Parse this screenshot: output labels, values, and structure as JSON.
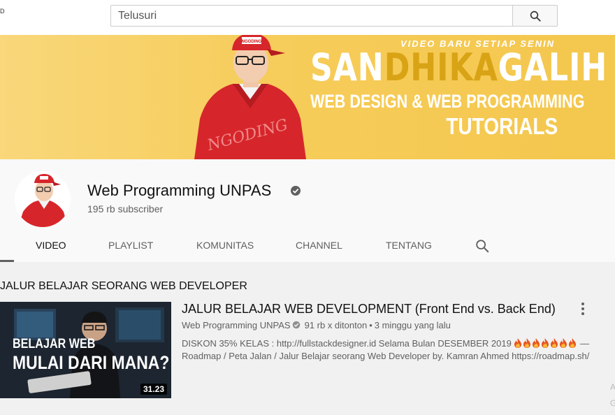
{
  "topbar": {
    "logo_stub": "D",
    "search_placeholder": "Telusuri",
    "search_icon": "search-icon"
  },
  "banner": {
    "tagline": "VIDEO BARU SETIAP SENIN",
    "name_part1": "SAN",
    "name_part2": "DHIKA",
    "name_part3": "GALIH",
    "subtitle": "WEB DESIGN & WEB PROGRAMMING",
    "subtitle2": "TUTORIALS",
    "shirt_text": "NGODING",
    "cap_text": "NGODING",
    "accent_color": "#f4c74d"
  },
  "channel": {
    "name": "Web Programming UNPAS",
    "subscribers": "195 rb subscriber",
    "verified_icon": "check-circle-icon"
  },
  "tabs": [
    {
      "label": "VIDEO",
      "active": true
    },
    {
      "label": "PLAYLIST",
      "active": false
    },
    {
      "label": "KOMUNITAS",
      "active": false
    },
    {
      "label": "CHANNEL",
      "active": false
    },
    {
      "label": "TENTANG",
      "active": false
    }
  ],
  "section": {
    "title": "JALUR BELAJAR SEORANG WEB DEVELOPER"
  },
  "video": {
    "thumb_line1": "BELAJAR WEB",
    "thumb_line2": "MULAI DARI MANA?",
    "duration": "31.23",
    "title": "JALUR BELAJAR WEB DEVELOPMENT (Front End vs. Back End)",
    "channel": "Web Programming UNPAS",
    "views": "91 rb x ditonton",
    "age": "3 minggu yang lalu",
    "desc_line1_prefix": "DISKON 35% KELAS : http://fullstackdesigner.id Selama Bulan DESEMBER 2019",
    "desc_line1_suffix": " —",
    "desc_line2": "Roadmap / Peta Jalan / Jalur Belajar seorang Web Developer by. Kamran Ahmed https://roadmap.sh/",
    "fire_count": 7
  }
}
